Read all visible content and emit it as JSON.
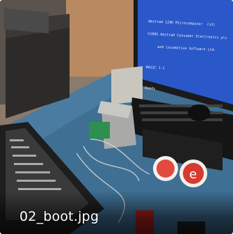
{
  "image": {
    "caption": "02_boot.jpg",
    "screen_lines": [
      "Amstrad 128K Microcomputer  (v3)",
      "©1985 Amstrad Consumer Electronics plc",
      "     and Locomotive Software Ltd.",
      "",
      "BASIC 1.1",
      "",
      "Ready"
    ]
  }
}
